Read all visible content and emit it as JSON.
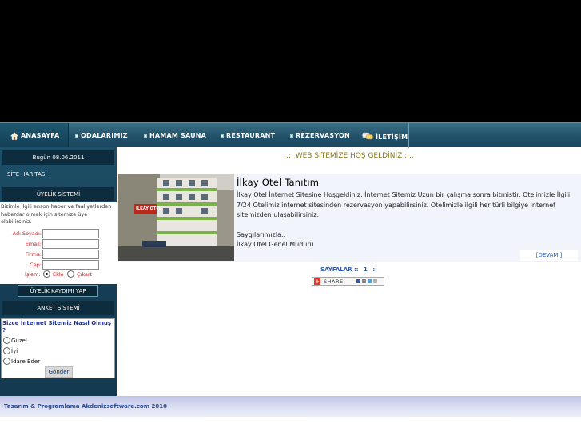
{
  "nav": {
    "items": [
      {
        "label": "ANASAYFA",
        "icon": "home-icon"
      },
      {
        "label": "ODALARIMIZ",
        "icon": "bullet-icon"
      },
      {
        "label": "HAMAM SAUNA",
        "icon": "bullet-icon"
      },
      {
        "label": "RESTAURANT",
        "icon": "bullet-icon"
      },
      {
        "label": "REZERVASYON",
        "icon": "bullet-icon"
      },
      {
        "label": "İLETİŞİM",
        "icon": "contact-icon"
      }
    ]
  },
  "sidebar": {
    "date": "Bugün 08.06.2011",
    "sitemap": "SİTE HARİTASI",
    "membership_title": "ÜYELİK SİSTEMİ",
    "membership_desc": "Bizimle ilgili enson haber ve faaliyetlerden haberdar olmak için sitemize üye olabilirsiniz.",
    "form": {
      "name_label": "Adı Soyadı:",
      "email_label": "Email:",
      "company_label": "Firma:",
      "mobile_label": "Cep:",
      "action_label": "İşlem:",
      "action_options": [
        "Ekle",
        "Çıkart"
      ],
      "action_selected": "Ekle"
    },
    "register_button": "ÜYELİK KAYDIMI YAP",
    "survey_title": "ANKET SİSTEMİ",
    "survey": {
      "question": "Sizce İnternet Sitemiz Nasıl Olmuş ?",
      "options": [
        "Güzel",
        "İyi",
        "İdare Eder"
      ],
      "submit": "Gönder"
    }
  },
  "main": {
    "welcome": "..:: WEB SİTEMİZE HOŞ GELDİNİZ ::..",
    "article": {
      "title": "İlkay Otel Tanıtım",
      "paragraph1": "İlkay Otel İnternet Sitesine Hoşgeldiniz. İnternet Sitemiz Uzun bir çalışma sonra bitmiştir. Otelimizle İlgili 7/24 Otelimiz internet sitesinden rezervasyon yapabilirsiniz. Otelimizle ilgili her türli bilgiye internet sitemizden ulaşabilirsiniz.",
      "signature1": "Saygılarımızla..",
      "signature2": "İlkay Otel Genel Müdürü",
      "more": "[DEVAMI]",
      "image_sign": "İLKAY OTEL"
    },
    "pager": {
      "label": "SAYFALAR ::",
      "page": "1",
      "suffix": "::"
    },
    "share": {
      "label": "SHARE"
    }
  },
  "footer": {
    "credit": "Tasarım & Programlama Akdenizsoftware.com 2010"
  },
  "colors": {
    "nav_bg": "#22516a",
    "sidebar_bg": "#163f57",
    "welcome_text": "#8a7a16",
    "link_blue": "#2a5ab0",
    "form_label_red": "#c02020"
  }
}
